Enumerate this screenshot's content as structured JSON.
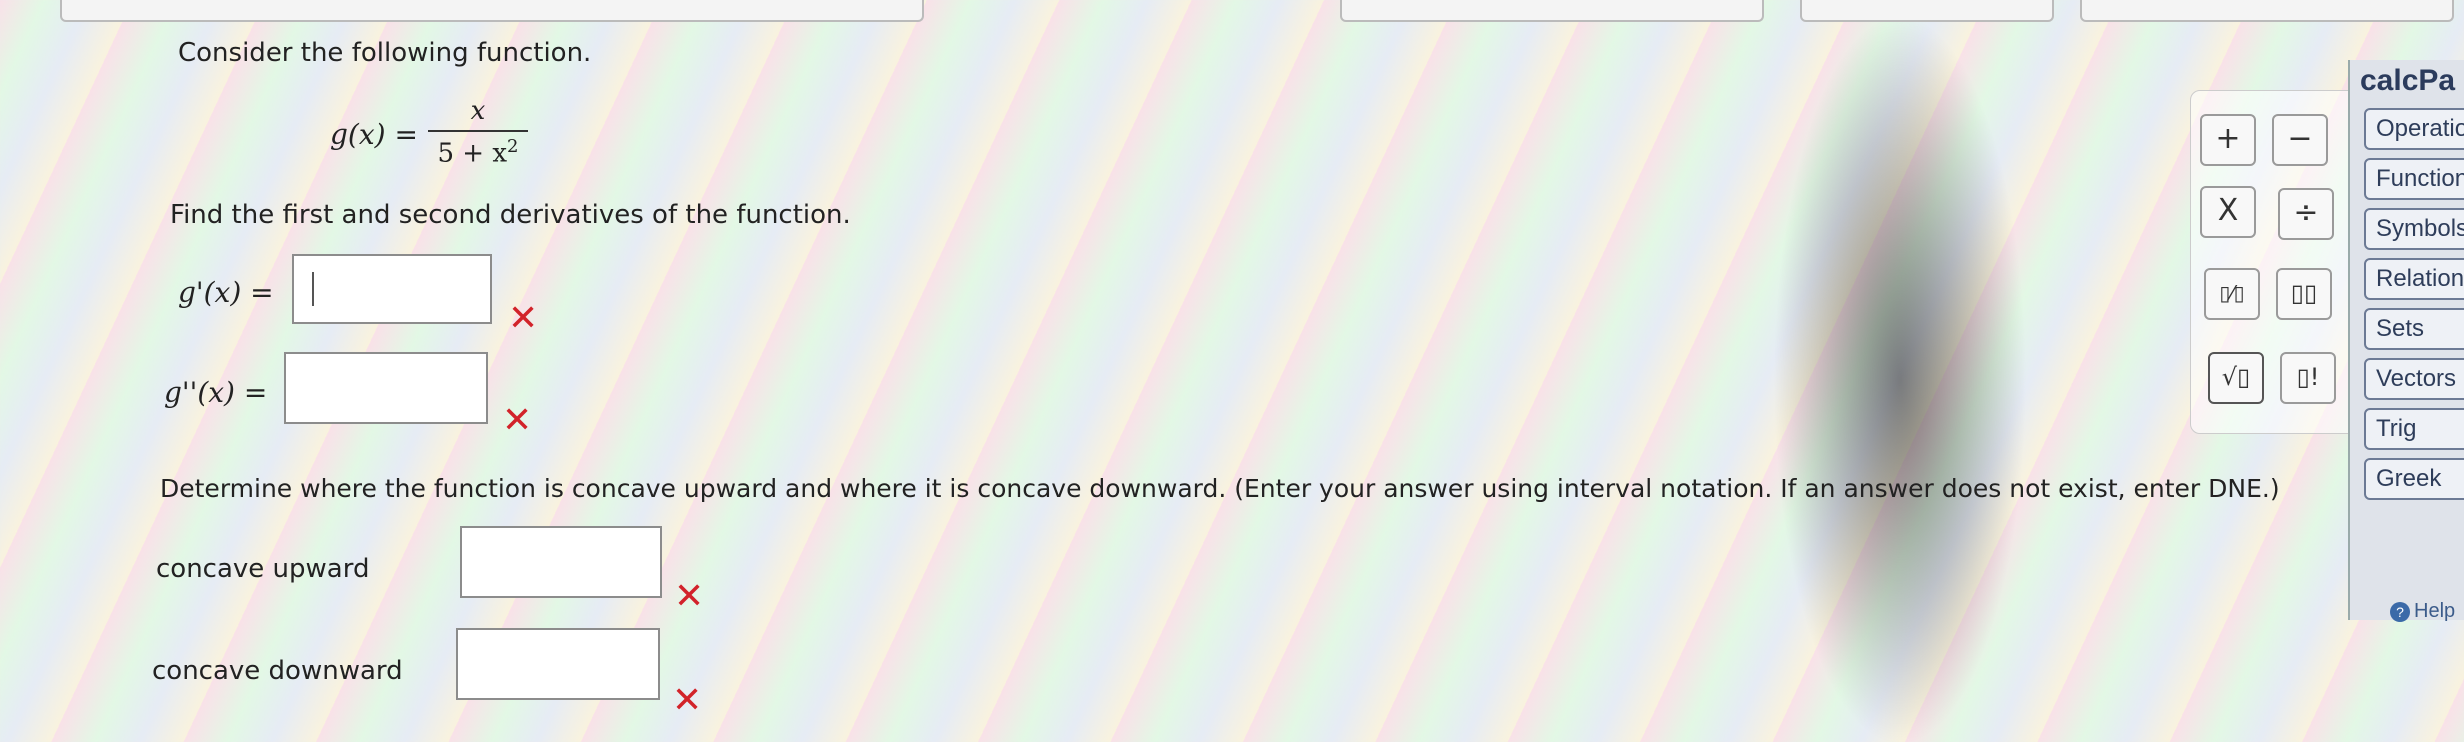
{
  "problem": {
    "intro": "Consider the following function.",
    "function_lhs": "g(x) =",
    "numerator": "x",
    "denominator": "5 + x",
    "denominator_exp": "2",
    "derivatives_prompt": "Find the first and second derivatives of the function.",
    "first_derivative_label": "g'(x) =",
    "second_derivative_label": "g''(x) =",
    "concavity_prompt": "Determine where the function is concave upward and where it is concave downward. (Enter your answer using interval notation. If an answer does not exist, enter DNE.)",
    "concave_up_label": "concave upward",
    "concave_down_label": "concave downward",
    "wrong_mark": "✕"
  },
  "answers": {
    "first_derivative": "",
    "second_derivative": "",
    "concave_up": "",
    "concave_down": ""
  },
  "keypad": {
    "plus": "+",
    "minus": "−",
    "times": "X",
    "divide": "÷",
    "fraction": "▯⁄▯",
    "power": "▯▯",
    "sqrt": "√▯",
    "factorial": "▯!"
  },
  "calcpad": {
    "title": "calcPa",
    "menu": [
      "Operatio",
      "Function",
      "Symbols",
      "Relation",
      "Sets",
      "Vectors",
      "Trig",
      "Greek"
    ],
    "help": "Help"
  }
}
